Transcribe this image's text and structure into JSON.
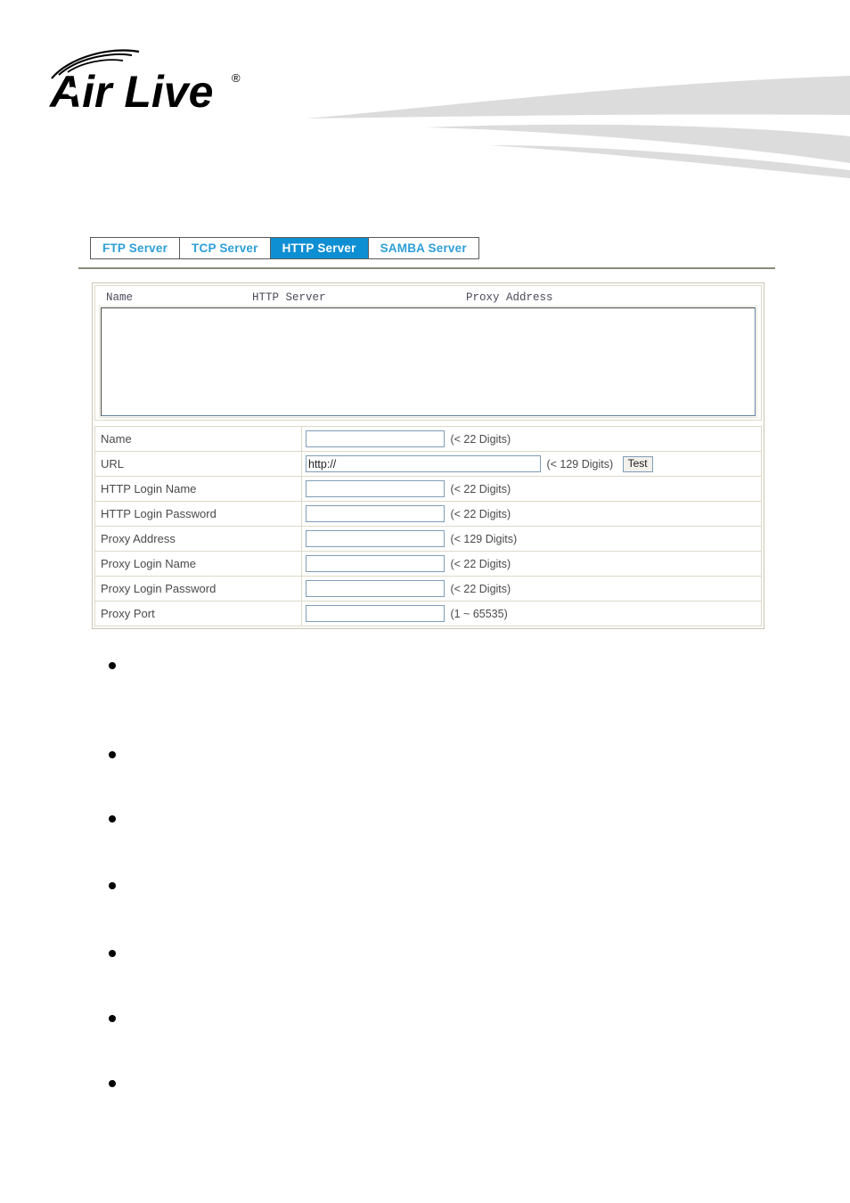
{
  "brand": {
    "logo_text": "Air Live",
    "logo_trademark": "®",
    "logo_icon": "wireless-arcs-icon"
  },
  "tabs": [
    {
      "label": "FTP Server",
      "active": false
    },
    {
      "label": "TCP Server",
      "active": false
    },
    {
      "label": "HTTP Server",
      "active": true
    },
    {
      "label": "SAMBA Server",
      "active": false
    }
  ],
  "list_panel": {
    "columns": [
      "Name",
      "HTTP Server",
      "Proxy Address"
    ],
    "rows": []
  },
  "form": {
    "rows": [
      {
        "label": "Name",
        "value": "",
        "hint": "(< 22 Digits)",
        "width": "std",
        "button": null
      },
      {
        "label": "URL",
        "value": "http://",
        "hint": "(< 129 Digits)",
        "width": "url",
        "button": "Test"
      },
      {
        "label": "HTTP Login Name",
        "value": "",
        "hint": "(< 22 Digits)",
        "width": "std",
        "button": null
      },
      {
        "label": "HTTP Login Password",
        "value": "",
        "hint": "(< 22 Digits)",
        "width": "std",
        "button": null
      },
      {
        "label": "Proxy Address",
        "value": "",
        "hint": "(< 129 Digits)",
        "width": "std",
        "button": null
      },
      {
        "label": "Proxy Login Name",
        "value": "",
        "hint": "(< 22 Digits)",
        "width": "std",
        "button": null
      },
      {
        "label": "Proxy Login Password",
        "value": "",
        "hint": "(< 22 Digits)",
        "width": "std",
        "button": null
      },
      {
        "label": "Proxy Port",
        "value": "",
        "hint": "(1 ~ 65535)",
        "width": "std",
        "button": null
      }
    ]
  },
  "notes": {
    "items": [
      "",
      "",
      "",
      "",
      "",
      "",
      ""
    ],
    "offsets": [
      0,
      100,
      172,
      247,
      323,
      396,
      469
    ]
  },
  "colors": {
    "tab_active_bg": "#0f8fd3",
    "tab_text": "#2e9fd8",
    "input_border": "#7f9db9",
    "table_border": "#ddd9c8",
    "rule": "#8a8a78",
    "banner": "#dcdcdc"
  }
}
